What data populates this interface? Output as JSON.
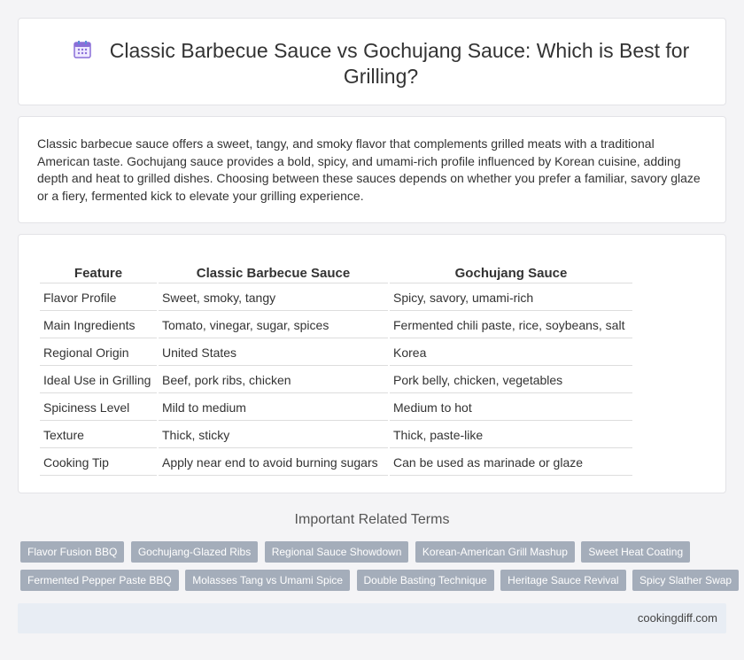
{
  "header": {
    "icon": "calendar-icon",
    "title": "Classic Barbecue Sauce vs Gochujang Sauce: Which is Best for Grilling?"
  },
  "intro": {
    "text": "Classic barbecue sauce offers a sweet, tangy, and smoky flavor that complements grilled meats with a traditional American taste. Gochujang sauce provides a bold, spicy, and umami-rich profile influenced by Korean cuisine, adding depth and heat to grilled dishes. Choosing between these sauces depends on whether you prefer a familiar, savory glaze or a fiery, fermented kick to elevate your grilling experience."
  },
  "table": {
    "headers": [
      "Feature",
      "Classic Barbecue Sauce",
      "Gochujang Sauce"
    ],
    "rows": [
      [
        "Flavor Profile",
        "Sweet, smoky, tangy",
        "Spicy, savory, umami-rich"
      ],
      [
        "Main Ingredients",
        "Tomato, vinegar, sugar, spices",
        "Fermented chili paste, rice, soybeans, salt"
      ],
      [
        "Regional Origin",
        "United States",
        "Korea"
      ],
      [
        "Ideal Use in Grilling",
        "Beef, pork ribs, chicken",
        "Pork belly, chicken, vegetables"
      ],
      [
        "Spiciness Level",
        "Mild to medium",
        "Medium to hot"
      ],
      [
        "Texture",
        "Thick, sticky",
        "Thick, paste-like"
      ],
      [
        "Cooking Tip",
        "Apply near end to avoid burning sugars",
        "Can be used as marinade or glaze"
      ]
    ]
  },
  "related": {
    "title": "Important Related Terms",
    "row1": [
      "Flavor Fusion BBQ",
      "Gochujang-Glazed Ribs",
      "Regional Sauce Showdown",
      "Korean-American Grill Mashup",
      "Sweet Heat Coating"
    ],
    "row2": [
      "Fermented Pepper Paste BBQ",
      "Molasses Tang vs Umami Spice",
      "Double Basting Technique",
      "Heritage Sauce Revival",
      "Spicy Slather Swap"
    ]
  },
  "footer": {
    "site": "cookingdiff.com"
  },
  "colors": {
    "tag_bg": "#a4adba",
    "footer_bg": "#e8edf4",
    "page_bg": "#f4f4f6",
    "icon_accent": "#8a6fd8"
  }
}
